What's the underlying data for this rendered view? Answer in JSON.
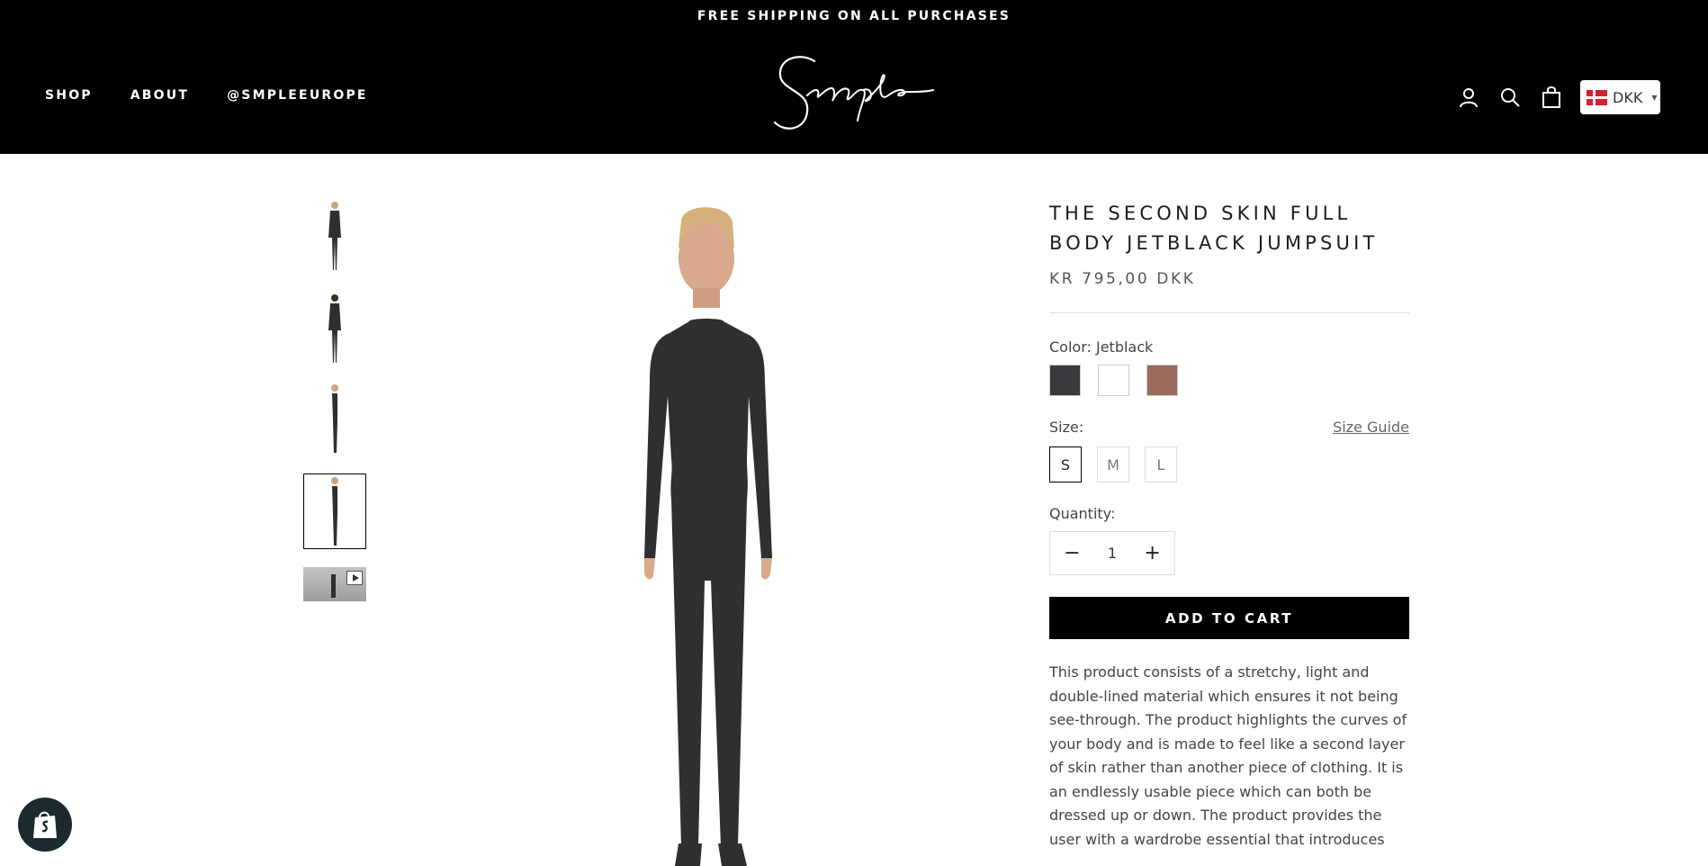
{
  "announcement": "FREE SHIPPING ON ALL PURCHASES",
  "nav": {
    "items": [
      "SHOP",
      "ABOUT",
      "@SMPLEEUROPE"
    ]
  },
  "brand": {
    "logo_text": "Smple"
  },
  "header_actions": {
    "account_icon": "user-icon",
    "search_icon": "search-icon",
    "cart_icon": "bag-icon",
    "currency": "DKK"
  },
  "gallery": {
    "thumbnail_count": 5,
    "active_index": 3,
    "video_thumb_icon": "play-icon"
  },
  "product": {
    "title": "THE SECOND SKIN FULL BODY JETBLACK JUMPSUIT",
    "price": "KR 795,00 DKK",
    "color_label": "Color:",
    "color_value": "Jetblack",
    "swatches": [
      {
        "name": "Jetblack",
        "color": "#3a3a3e"
      },
      {
        "name": "White",
        "color": "#ffffff"
      },
      {
        "name": "Brown",
        "color": "#9a6a5c"
      }
    ],
    "size_label": "Size:",
    "size_guide": "Size Guide",
    "sizes": [
      "S",
      "M",
      "L"
    ],
    "selected_size": "S",
    "quantity_label": "Quantity:",
    "quantity": "1",
    "add_to_cart": "ADD TO CART",
    "description": "This product consists of a stretchy, light and double-lined material which ensures it not being see-through. The product highlights the curves of your body and is made to feel like a second layer of skin rather than another piece of clothing. It is an endlessly usable piece which can both be dressed up or down. The product provides the user with a wardrobe essential that introduces"
  },
  "colors": {
    "header_bg": "#000000",
    "button_bg": "#000000",
    "jumpsuit": "#2f2f31"
  }
}
